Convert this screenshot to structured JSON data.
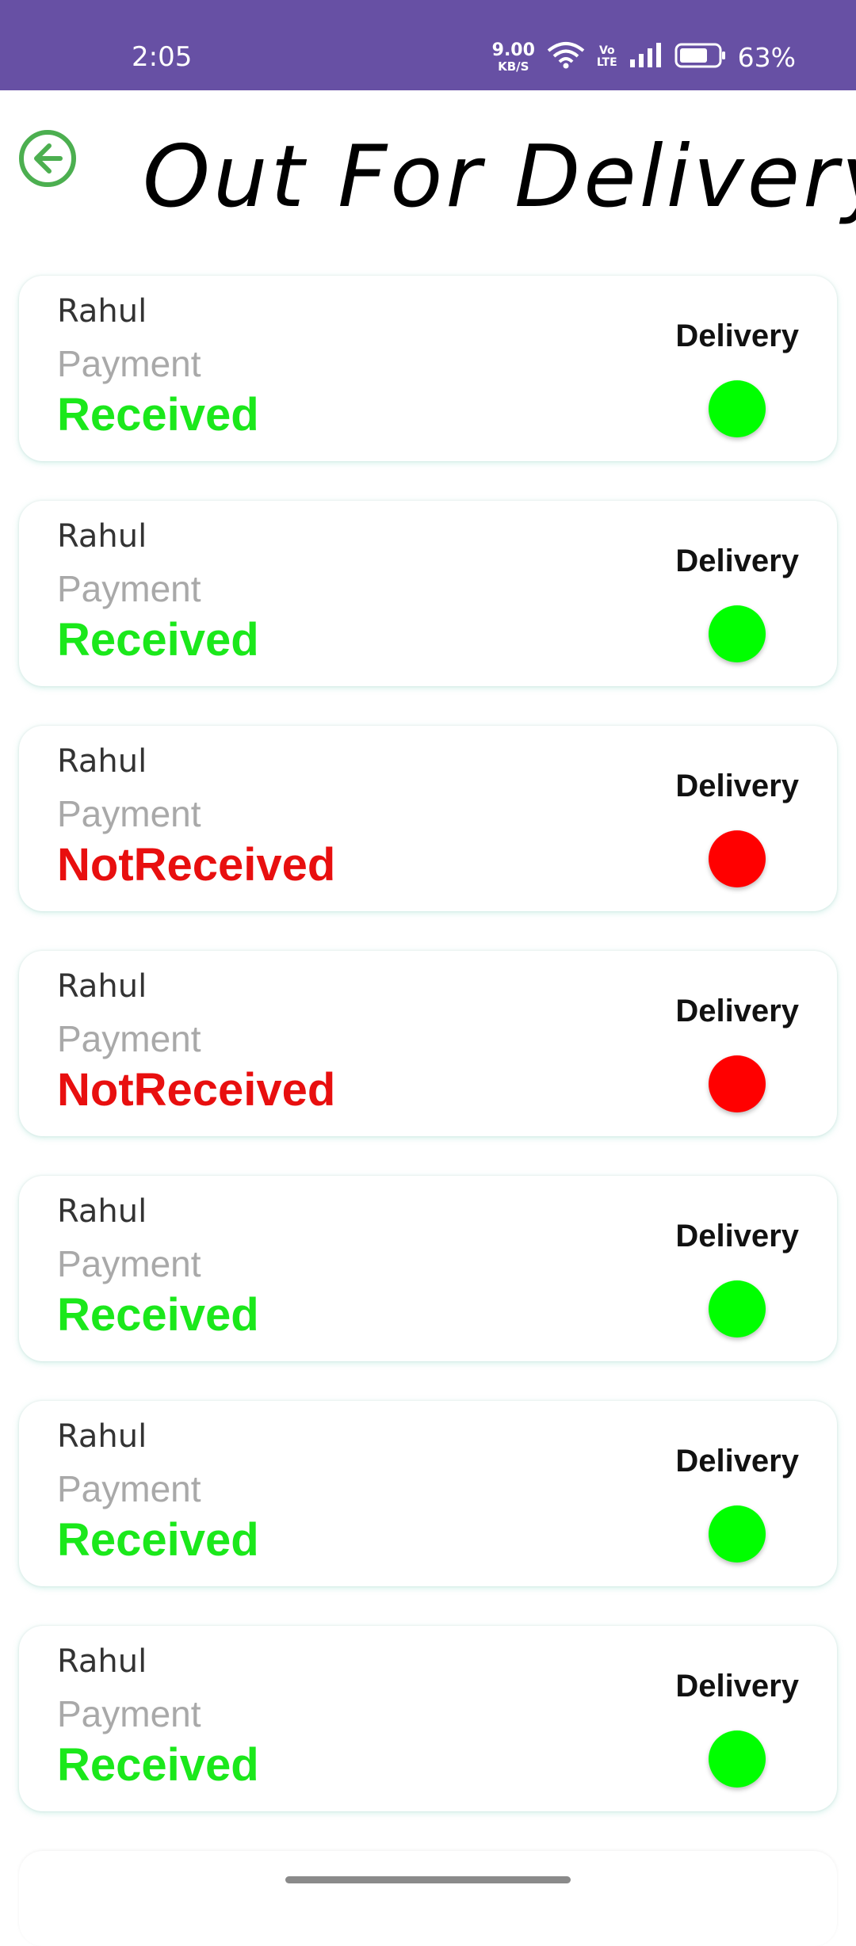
{
  "status_bar": {
    "time": "2:05",
    "net_speed_value": "9.00",
    "net_speed_unit": "KB/S",
    "volte_top": "Vo",
    "volte_bottom": "LTE",
    "battery_percent": "63%",
    "icons": [
      "wifi-icon",
      "signal-icon",
      "battery-icon"
    ]
  },
  "header": {
    "title": "Out For Delivery",
    "back_icon": "arrow-left-circle-icon"
  },
  "colors": {
    "status_bar_bg": "#6750A4",
    "back_icon": "#4CAF50",
    "received": "#1BE81B",
    "not_received": "#E80F0F",
    "dot_green": "#00FF00",
    "dot_red": "#FF0000"
  },
  "orders": [
    {
      "name": "Rahul",
      "payment_label": "Payment",
      "payment_status": "Received",
      "delivery_label": "Delivery",
      "status_color": "#1BE81B",
      "dot_color": "#00FF00"
    },
    {
      "name": "Rahul",
      "payment_label": "Payment",
      "payment_status": "Received",
      "delivery_label": "Delivery",
      "status_color": "#1BE81B",
      "dot_color": "#00FF00"
    },
    {
      "name": "Rahul",
      "payment_label": "Payment",
      "payment_status": "NotReceived",
      "delivery_label": "Delivery",
      "status_color": "#E80F0F",
      "dot_color": "#FF0000"
    },
    {
      "name": "Rahul",
      "payment_label": "Payment",
      "payment_status": "NotReceived",
      "delivery_label": "Delivery",
      "status_color": "#E80F0F",
      "dot_color": "#FF0000"
    },
    {
      "name": "Rahul",
      "payment_label": "Payment",
      "payment_status": "Received",
      "delivery_label": "Delivery",
      "status_color": "#1BE81B",
      "dot_color": "#00FF00"
    },
    {
      "name": "Rahul",
      "payment_label": "Payment",
      "payment_status": "Received",
      "delivery_label": "Delivery",
      "status_color": "#1BE81B",
      "dot_color": "#00FF00"
    },
    {
      "name": "Rahul",
      "payment_label": "Payment",
      "payment_status": "Received",
      "delivery_label": "Delivery",
      "status_color": "#1BE81B",
      "dot_color": "#00FF00"
    }
  ]
}
